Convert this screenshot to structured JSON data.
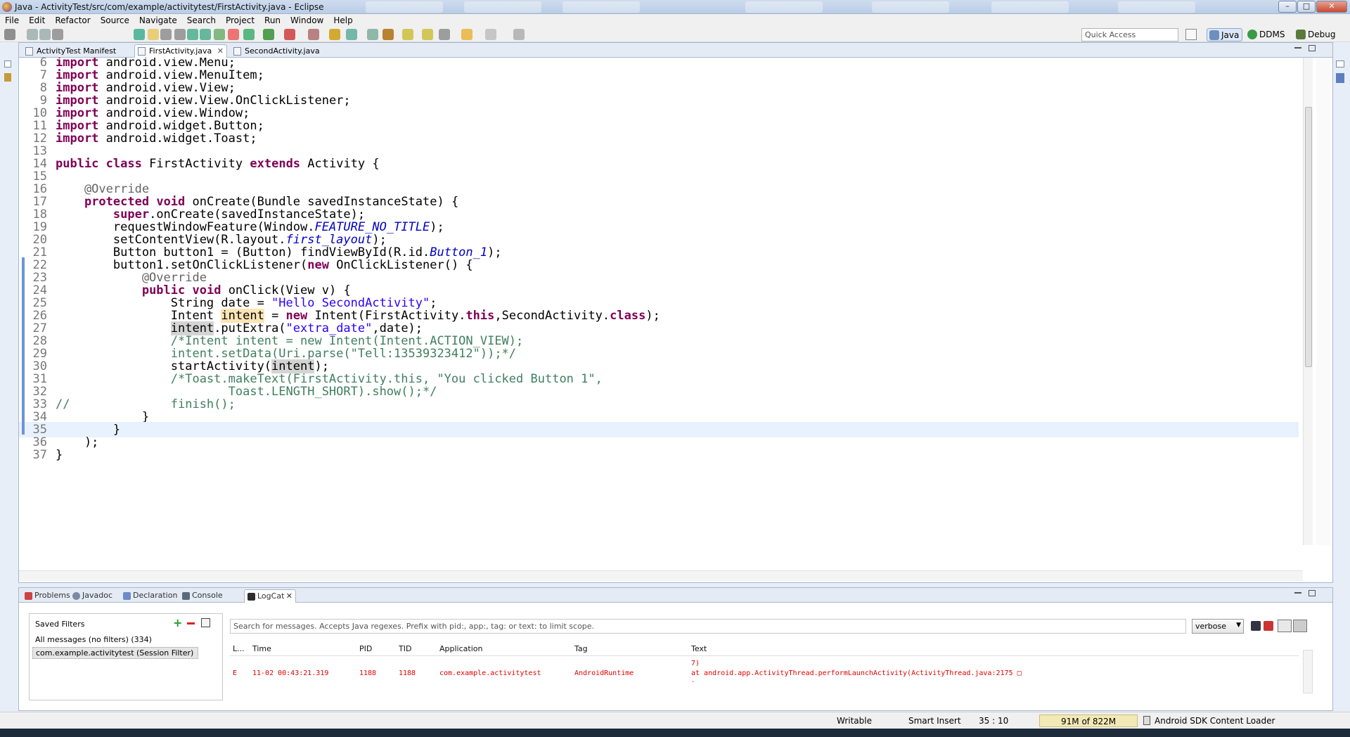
{
  "window": {
    "title": "Java - ActivityTest/src/com/example/activitytest/FirstActivity.java - Eclipse",
    "minimize": "–",
    "maximize": "□",
    "close": "✕"
  },
  "menu": [
    "File",
    "Edit",
    "Refactor",
    "Source",
    "Navigate",
    "Search",
    "Project",
    "Run",
    "Window",
    "Help"
  ],
  "toolbar": {
    "quick_access_placeholder": "Quick Access",
    "perspectives": [
      "Java",
      "DDMS",
      "Debug"
    ]
  },
  "editor": {
    "tabs": [
      {
        "label": "ActivityTest Manifest",
        "active": false
      },
      {
        "label": "FirstActivity.java",
        "active": true,
        "close": "✕"
      },
      {
        "label": "SecondActivity.java",
        "active": false
      }
    ],
    "lines": [
      {
        "n": "6",
        "t": "import android.view.Menu;"
      },
      {
        "n": "7",
        "t": "import android.view.MenuItem;"
      },
      {
        "n": "8",
        "t": "import android.view.View;"
      },
      {
        "n": "9",
        "t": "import android.view.View.OnClickListener;"
      },
      {
        "n": "10",
        "t": "import android.view.Window;"
      },
      {
        "n": "11",
        "t": "import android.widget.Button;"
      },
      {
        "n": "12",
        "t": "import android.widget.Toast;"
      },
      {
        "n": "13",
        "t": ""
      },
      {
        "n": "14",
        "t": "public class FirstActivity extends Activity {"
      },
      {
        "n": "15",
        "t": ""
      },
      {
        "n": "16",
        "t": "    @Override"
      },
      {
        "n": "17",
        "t": "    protected void onCreate(Bundle savedInstanceState) {"
      },
      {
        "n": "18",
        "t": "        super.onCreate(savedInstanceState);"
      },
      {
        "n": "19",
        "t": "        requestWindowFeature(Window.FEATURE_NO_TITLE);"
      },
      {
        "n": "20",
        "t": "        setContentView(R.layout.first_layout);"
      },
      {
        "n": "21",
        "t": "        Button button1 = (Button) findViewById(R.id.Button_1);"
      },
      {
        "n": "22",
        "t": "        button1.setOnClickListener(new OnClickListener() {"
      },
      {
        "n": "23",
        "t": "            @Override"
      },
      {
        "n": "24",
        "t": "            public void onClick(View v) {"
      },
      {
        "n": "25",
        "t": "                String date = \"Hello SecondActivity\";"
      },
      {
        "n": "26",
        "t": "                Intent intent = new Intent(FirstActivity.this,SecondActivity.class);"
      },
      {
        "n": "27",
        "t": "                intent.putExtra(\"extra_date\",date);"
      },
      {
        "n": "28",
        "t": "                /*Intent intent = new Intent(Intent.ACTION_VIEW);"
      },
      {
        "n": "29",
        "t": "                intent.setData(Uri.parse(\"Tell:13539323412\"));*/"
      },
      {
        "n": "30",
        "t": "                startActivity(intent);"
      },
      {
        "n": "31",
        "t": "                /*Toast.makeText(FirstActivity.this, \"You clicked Button 1\","
      },
      {
        "n": "32",
        "t": "                        Toast.LENGTH_SHORT).show();*/"
      },
      {
        "n": "33",
        "t": "//              finish();"
      },
      {
        "n": "34",
        "t": "            }"
      },
      {
        "n": "35",
        "t": "        }"
      },
      {
        "n": "36",
        "t": "    );"
      },
      {
        "n": "37",
        "t": "}"
      }
    ]
  },
  "bottom_panel": {
    "tabs": [
      {
        "label": "Problems",
        "active": false
      },
      {
        "label": "Javadoc",
        "active": false
      },
      {
        "label": "Declaration",
        "active": false
      },
      {
        "label": "Console",
        "active": false
      },
      {
        "label": "LogCat",
        "active": true,
        "close": "✕"
      }
    ],
    "saved_filters_label": "Saved Filters",
    "filters": [
      "All messages (no filters) (334)",
      "com.example.activitytest (Session Filter)"
    ],
    "search_placeholder": "Search for messages. Accepts Java regexes. Prefix with pid:, app:, tag: or text: to limit scope.",
    "level": "verbose",
    "columns": [
      "L...",
      "Time",
      "PID",
      "TID",
      "Application",
      "Tag",
      "Text"
    ],
    "row_above_text": "7)",
    "row": {
      "level": "E",
      "time": "11-02 00:43:21.319",
      "pid": "1188",
      "tid": "1188",
      "app": "com.example.activitytest",
      "tag": "AndroidRuntime",
      "text": "at android.app.ActivityThread.performLaunchActivity(ActivityThread.java:2175 □"
    },
    "row_below_text": "`"
  },
  "statusbar": {
    "writable": "Writable",
    "insert_mode": "Smart Insert",
    "position": "35 : 10",
    "memory": "91M of 822M",
    "task": "Android SDK Content Loader"
  }
}
